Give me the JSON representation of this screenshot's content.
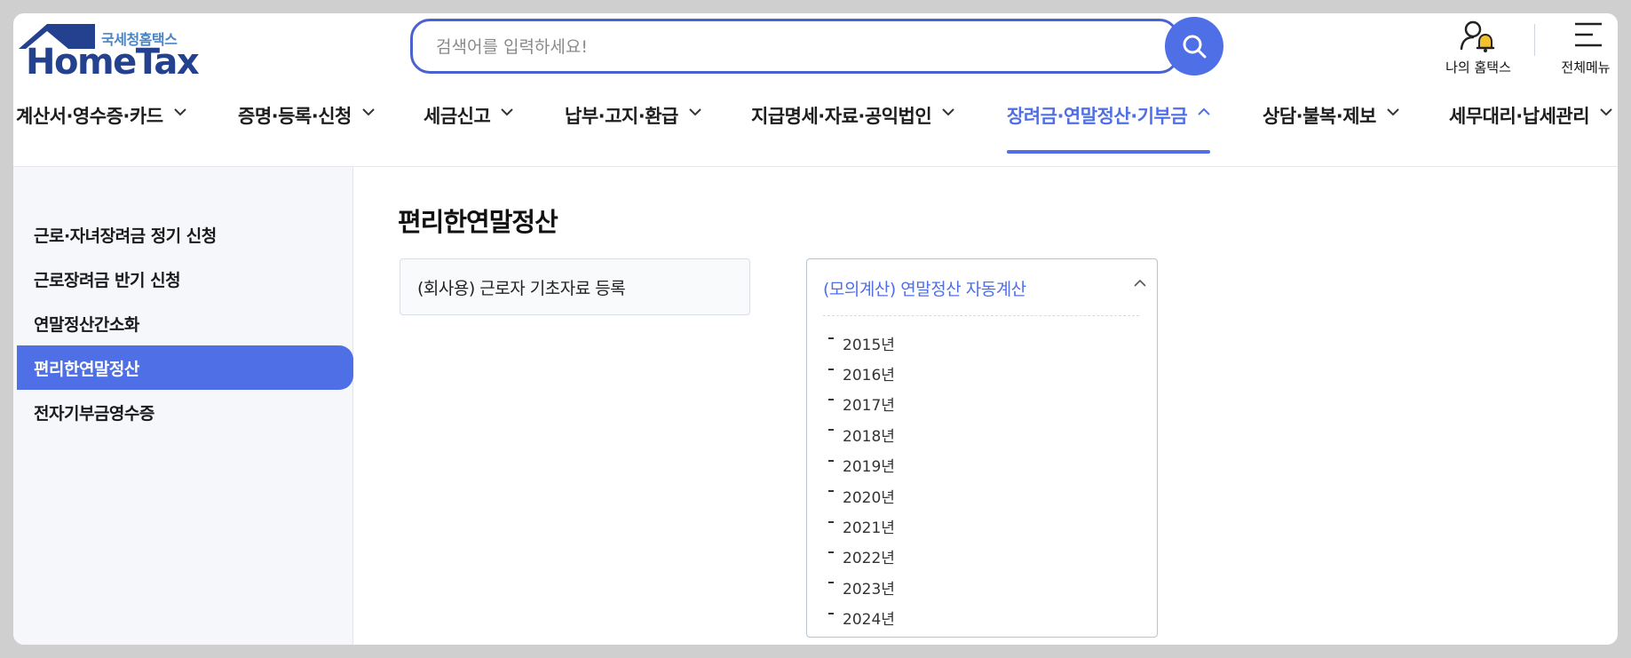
{
  "header": {
    "logo_sub": "국세청홈택스",
    "logo_main": "HomeTax",
    "search_placeholder": "검색어를 입력하세요!",
    "my_hometax_label": "나의 홈택스",
    "all_menu_label": "전체메뉴"
  },
  "gnb": {
    "items": [
      {
        "label": "계산서·영수증·카드"
      },
      {
        "label": "증명·등록·신청"
      },
      {
        "label": "세금신고"
      },
      {
        "label": "납부·고지·환급"
      },
      {
        "label": "지급명세·자료·공익법인"
      },
      {
        "label": "장려금·연말정산·기부금",
        "active": true
      },
      {
        "label": "상담·불복·제보"
      },
      {
        "label": "세무대리·납세관리"
      }
    ]
  },
  "sidebar": {
    "items": [
      {
        "label": "근로·자녀장려금 정기 신청"
      },
      {
        "label": "근로장려금 반기 신청"
      },
      {
        "label": "연말정산간소화"
      },
      {
        "label": "편리한연말정산",
        "active": true
      },
      {
        "label": "전자기부금영수증"
      }
    ]
  },
  "main": {
    "title": "편리한연말정산",
    "card1_label": "(회사용) 근로자 기초자료 등록",
    "card2": {
      "label": "(모의계산) 연말정산 자동계산",
      "years": [
        "2015년",
        "2016년",
        "2017년",
        "2018년",
        "2019년",
        "2020년",
        "2021년",
        "2022년",
        "2023년",
        "2024년"
      ]
    }
  },
  "colors": {
    "accent": "#4e6fe6",
    "logo_blue": "#24418f",
    "sidebar_bg": "#f5f7fb"
  }
}
